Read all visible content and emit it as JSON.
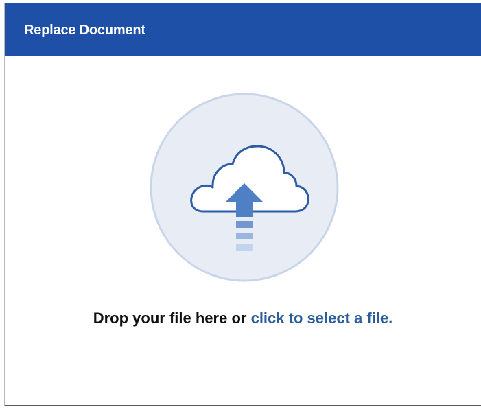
{
  "dialog": {
    "title": "Replace Document"
  },
  "drop_zone": {
    "icon": "cloud-upload-icon",
    "prompt_text": "Drop your file here or",
    "link_text": "click to select a file."
  },
  "colors": {
    "header_background": "#1f50a8",
    "link": "#2b5d9b",
    "circle_fill": "#e7ecf5",
    "circle_border": "#c9d6ea",
    "arrow": "#4f7fc5"
  }
}
